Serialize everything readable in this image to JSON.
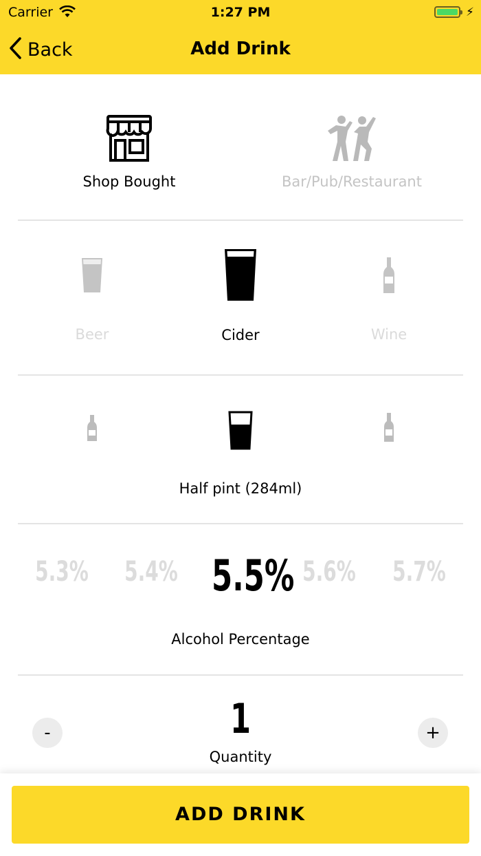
{
  "status_bar": {
    "carrier": "Carrier",
    "time": "1:27 PM"
  },
  "nav": {
    "back_label": "Back",
    "title": "Add Drink"
  },
  "venue": {
    "options": [
      {
        "label": "Shop Bought",
        "icon": "shop-icon",
        "selected": true
      },
      {
        "label": "Bar/Pub/Restaurant",
        "icon": "dancing-people-icon",
        "selected": false
      }
    ]
  },
  "drink_type": {
    "options": [
      {
        "label": "Beer",
        "icon": "pint-glass-icon",
        "selected": false
      },
      {
        "label": "Cider",
        "icon": "pint-glass-icon",
        "selected": true
      },
      {
        "label": "Wine",
        "icon": "wine-bottle-icon",
        "selected": false
      }
    ]
  },
  "size": {
    "selected_label": "Half pint (284ml)",
    "options": [
      {
        "icon": "small-bottle-icon",
        "selected": false
      },
      {
        "icon": "half-pint-glass-icon",
        "selected": true
      },
      {
        "icon": "bottle-icon",
        "selected": false
      }
    ]
  },
  "alcohol": {
    "label": "Alcohol Percentage",
    "options": [
      "5.3%",
      "5.4%",
      "5.5%",
      "5.6%",
      "5.7%"
    ],
    "selected": "5.5%"
  },
  "quantity": {
    "value": "1",
    "label": "Quantity",
    "decrement": "-",
    "increment": "+"
  },
  "footer": {
    "button_label": "ADD DRINK"
  },
  "colors": {
    "accent": "#fcd929",
    "selected": "#000000",
    "unselected": "#c4c4c4",
    "divider": "#e4e4e4"
  }
}
